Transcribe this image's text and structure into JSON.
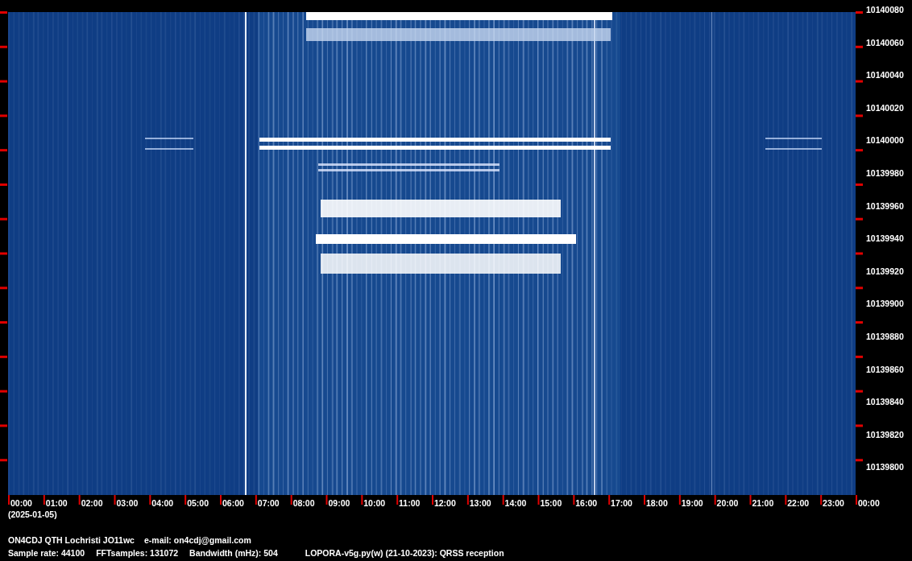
{
  "frequency_axis": {
    "labels": [
      "10140080",
      "10140060",
      "10140040",
      "10140020",
      "10140000",
      "10139980",
      "10139960",
      "10139940",
      "10139920",
      "10139900",
      "10139880",
      "10139860",
      "10139840",
      "10139820",
      "10139800"
    ]
  },
  "time_axis": {
    "labels": [
      "00:00",
      "01:00",
      "02:00",
      "03:00",
      "04:00",
      "05:00",
      "06:00",
      "07:00",
      "08:00",
      "09:00",
      "10:00",
      "11:00",
      "12:00",
      "13:00",
      "14:00",
      "15:00",
      "16:00",
      "17:00",
      "18:00",
      "19:00",
      "20:00",
      "21:00",
      "22:00",
      "23:00",
      "00:00"
    ],
    "date": "(2025-01-05)"
  },
  "footer": {
    "station": "ON4CDJ QTH Lochristi JO11wc",
    "email": "e-mail: on4cdj@gmail.com",
    "parameters": [
      "Sample rate: 44100",
      "FFTsamples: 131072",
      "Bandwidth (mHz): 504"
    ],
    "software": "LOPORA-v5g.py(w) (21-10-2023): QRSS reception"
  }
}
